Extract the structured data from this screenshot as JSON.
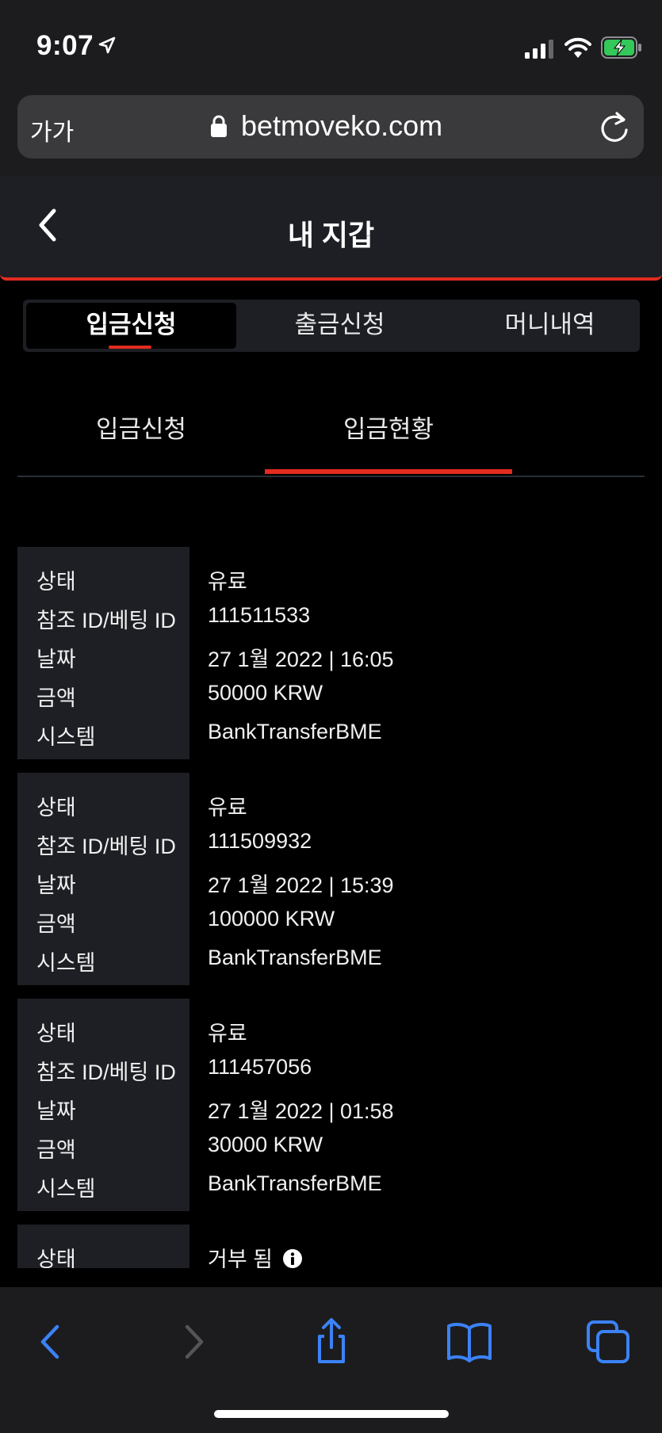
{
  "status_bar": {
    "time": "9:07"
  },
  "browser": {
    "text_size_label": "가가",
    "url": "betmoveko.com"
  },
  "header": {
    "title": "내 지갑"
  },
  "tabs": [
    {
      "label": "입금신청",
      "active": true
    },
    {
      "label": "출금신청",
      "active": false
    },
    {
      "label": "머니내역",
      "active": false
    }
  ],
  "subtabs": [
    {
      "label": "입금신청",
      "active": false
    },
    {
      "label": "입금현황",
      "active": true
    }
  ],
  "field_labels": {
    "status": "상태",
    "reference": "참조 ID/베팅 ID",
    "date": "날짜",
    "amount": "금액",
    "system": "시스템"
  },
  "records": [
    {
      "status": "유료",
      "reference": "111511533",
      "date": "27 1월 2022 | 16:05",
      "amount": "50000 KRW",
      "system": "BankTransferBME"
    },
    {
      "status": "유료",
      "reference": "111509932",
      "date": "27 1월 2022 | 15:39",
      "amount": "100000 KRW",
      "system": "BankTransferBME"
    },
    {
      "status": "유료",
      "reference": "111457056",
      "date": "27 1월 2022 | 01:58",
      "amount": "30000 KRW",
      "system": "BankTransferBME"
    },
    {
      "status": "거부 됨",
      "reference": "",
      "date": "",
      "amount": "",
      "system": ""
    }
  ],
  "colors": {
    "accent": "#e22c20",
    "panel": "#1d1f24",
    "browser_chrome": "#1c1c1e",
    "link_blue": "#3b82f6"
  },
  "icons": [
    "location-arrow-icon",
    "signal-icon",
    "wifi-icon",
    "battery-charging-icon",
    "lock-icon",
    "reload-icon",
    "back-chevron-icon",
    "info-icon",
    "browser-back-icon",
    "browser-forward-icon",
    "share-icon",
    "bookmarks-icon",
    "tabs-icon"
  ]
}
